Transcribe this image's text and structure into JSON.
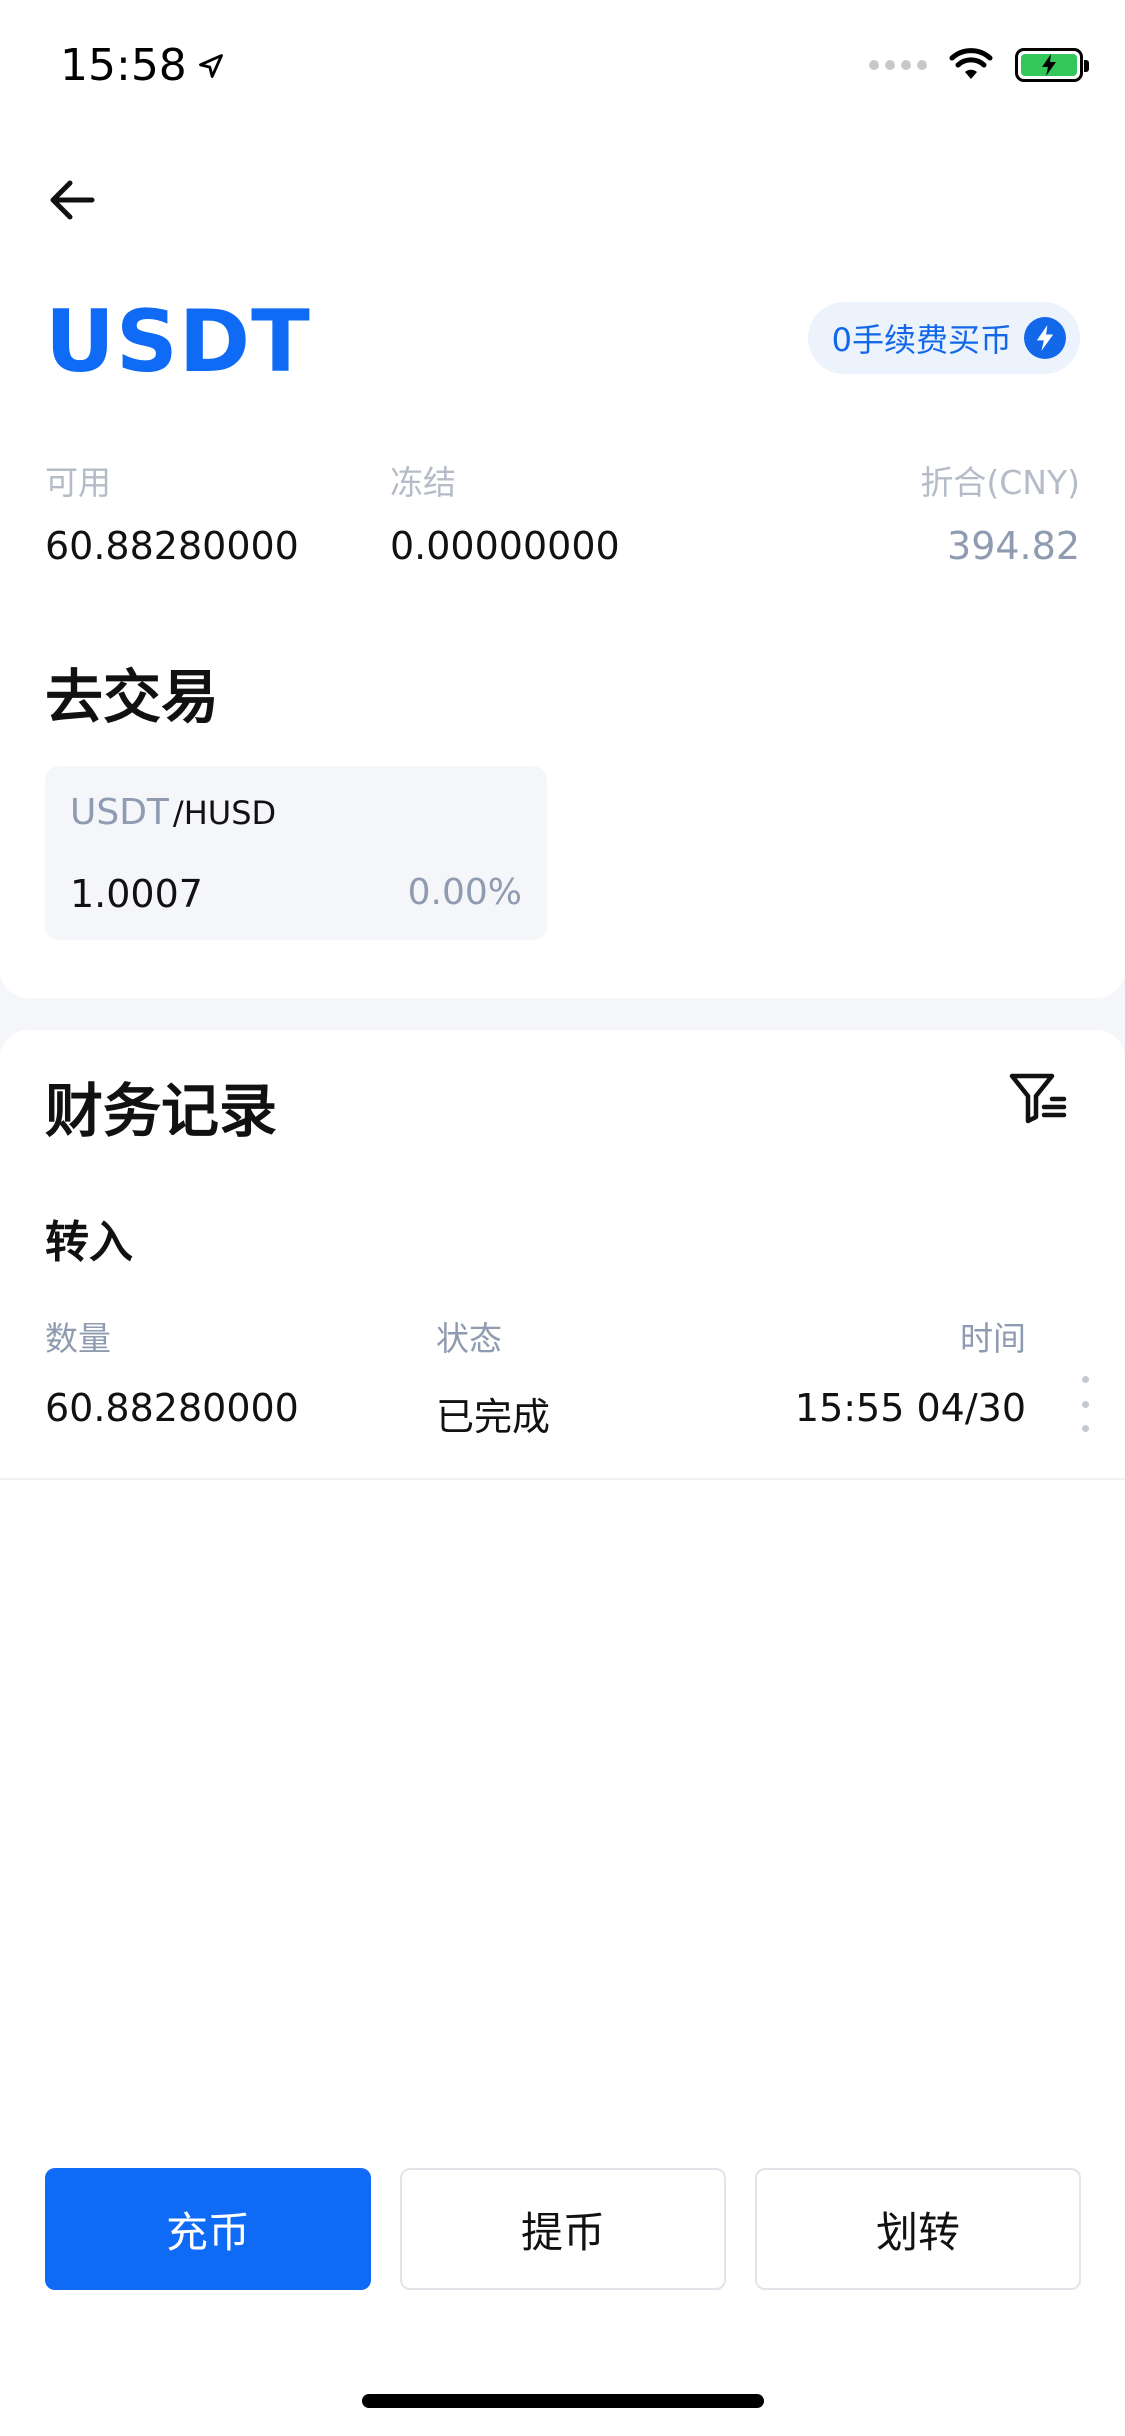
{
  "status_bar": {
    "time": "15:58"
  },
  "header": {
    "coin": "USDT",
    "promo_label": "0手续费买币"
  },
  "balances": {
    "available_label": "可用",
    "available_value": "60.88280000",
    "frozen_label": "冻结",
    "frozen_value": "0.00000000",
    "equiv_label": "折合(CNY)",
    "equiv_value": "394.82"
  },
  "trade": {
    "title": "去交易",
    "pair_base": "USDT",
    "pair_quote": "/HUSD",
    "price": "1.0007",
    "change": "0.00%"
  },
  "records": {
    "title": "财务记录",
    "type_label": "转入",
    "col_amount": "数量",
    "col_status": "状态",
    "col_time": "时间",
    "row": {
      "amount": "60.88280000",
      "status": "已完成",
      "time": "15:55 04/30"
    }
  },
  "actions": {
    "deposit": "充币",
    "withdraw": "提币",
    "transfer": "划转"
  },
  "colors": {
    "accent": "#0f6bf5",
    "muted": "#8f9bb0",
    "battery": "#34c759"
  }
}
